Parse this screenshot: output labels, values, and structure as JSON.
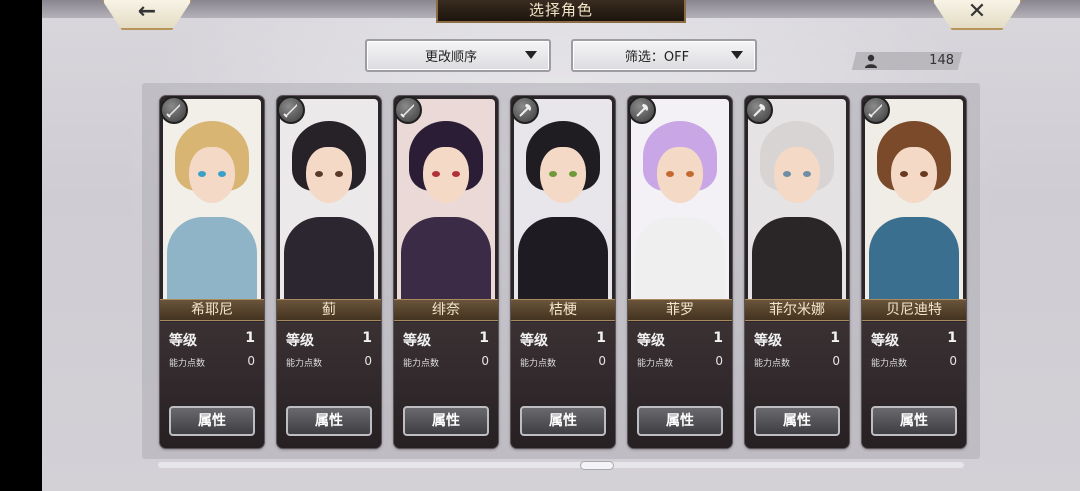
{
  "header": {
    "title": "选择角色",
    "back_icon": "←",
    "close_icon": "✕"
  },
  "controls": {
    "sort_label": "更改顺序",
    "filter_label": "筛选：OFF",
    "character_count": "148"
  },
  "stat_labels": {
    "level": "等级",
    "ability_points": "能力点数",
    "attribute_button": "属性"
  },
  "characters": [
    {
      "name": "希耶尼",
      "level": "1",
      "ability_points": "0",
      "weapon": "sword",
      "hair": "#d9b574",
      "eye": "#3aa0c8",
      "body": "#8fb4c8",
      "bg": "#f2efe9"
    },
    {
      "name": "蓟",
      "level": "1",
      "ability_points": "0",
      "weapon": "sword",
      "hair": "#262228",
      "eye": "#5a3b2a",
      "body": "#2c2630",
      "bg": "#ece9ea"
    },
    {
      "name": "绯奈",
      "level": "1",
      "ability_points": "0",
      "weapon": "sword",
      "hair": "#2b1d36",
      "eye": "#b2303a",
      "body": "#3b2b47",
      "bg": "#ead9d6"
    },
    {
      "name": "桔梗",
      "level": "1",
      "ability_points": "0",
      "weapon": "axe",
      "hair": "#1f1c22",
      "eye": "#6e9a3a",
      "body": "#1e1b22",
      "bg": "#e8e6ea"
    },
    {
      "name": "菲罗",
      "level": "1",
      "ability_points": "0",
      "weapon": "axe",
      "hair": "#c9a6e6",
      "eye": "#c26a2f",
      "body": "#efefef",
      "bg": "#f4f1f6"
    },
    {
      "name": "菲尔米娜",
      "level": "1",
      "ability_points": "0",
      "weapon": "axe",
      "hair": "#d8d4d3",
      "eye": "#6f8ea5",
      "body": "#2a2628",
      "bg": "#e6e3e4"
    },
    {
      "name": "贝尼迪特",
      "level": "1",
      "ability_points": "0",
      "weapon": "sword",
      "hair": "#7b4a2a",
      "eye": "#6a3a20",
      "body": "#3a6f8f",
      "bg": "#f0ece6"
    }
  ]
}
